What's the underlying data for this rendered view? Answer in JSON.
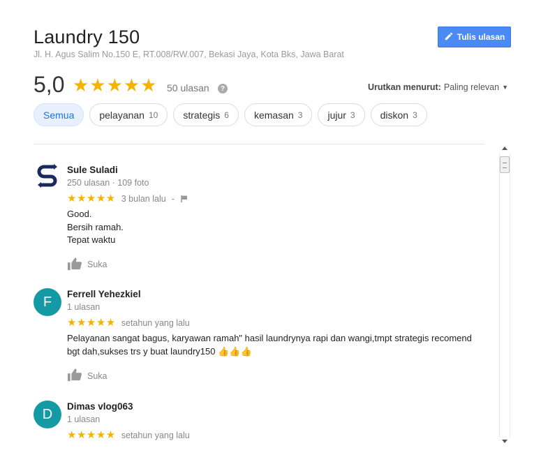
{
  "place": {
    "name": "Laundry 150",
    "address": "Jl. H. Agus Salim No.150 E, RT.008/RW.007, Bekasi Jaya, Kota Bks, Jawa Barat"
  },
  "write_review": {
    "label": "Tulis ulasan",
    "icon": "pencil-icon"
  },
  "summary": {
    "rating": "5,0",
    "stars": "★★★★★",
    "review_count": "50 ulasan",
    "help_icon": "?"
  },
  "sort": {
    "label": "Urutkan menurut:",
    "value": "Paling relevan",
    "caret": "▼"
  },
  "chips": [
    {
      "label": "Semua",
      "count": ""
    },
    {
      "label": "pelayanan",
      "count": "10"
    },
    {
      "label": "strategis",
      "count": "6"
    },
    {
      "label": "kemasan",
      "count": "3"
    },
    {
      "label": "jujur",
      "count": "3"
    },
    {
      "label": "diskon",
      "count": "3"
    }
  ],
  "reviews": [
    {
      "name": "Sule Suladi",
      "meta": "250 ulasan · 109 foto",
      "avatar_letter": "",
      "avatar_icon": "s-logo-icon",
      "stars": "★★★★★",
      "time": "3 bulan lalu",
      "separator": "-",
      "text_lines": [
        "Good.",
        "Bersih ramah.",
        "Tepat waktu"
      ],
      "like_label": "Suka"
    },
    {
      "name": "Ferrell Yehezkiel",
      "meta": "1 ulasan",
      "avatar_letter": "F",
      "avatar_color": "#139aa4",
      "stars": "★★★★★",
      "time": "setahun yang lalu",
      "text_lines": [
        "Pelayanan sangat bagus, karyawan ramah\" hasil laundrynya rapi dan wangi,tmpt strategis recomend",
        "bgt dah,sukses trs y buat laundry150 👍👍👍"
      ],
      "like_label": "Suka"
    },
    {
      "name": "Dimas vlog063",
      "meta": "1 ulasan",
      "avatar_letter": "D",
      "avatar_color": "#139aa4",
      "stars": "★★★★★",
      "time": "setahun yang lalu"
    }
  ]
}
